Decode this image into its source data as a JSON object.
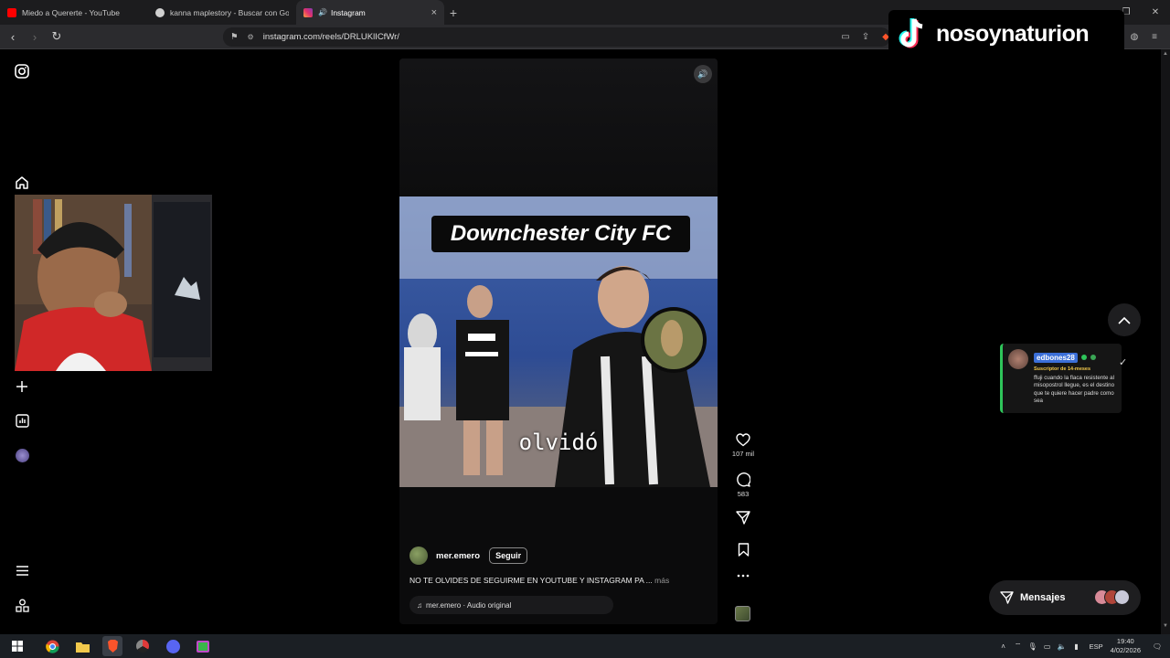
{
  "browser": {
    "tabs": [
      {
        "title": "Miedo a Quererte - YouTube",
        "favicon_color": "#ff0000",
        "active": false
      },
      {
        "title": "kanna maplestory - Buscar con Goog",
        "favicon_color": "#d0d0d0",
        "active": false
      },
      {
        "title": "Instagram",
        "favicon_color": "#e1306c",
        "active": true,
        "audio": true
      }
    ],
    "close_glyph": "×",
    "new_tab_glyph": "+",
    "url": "instagram.com/reels/DRLUKlICfWr/",
    "window_controls": [
      "—",
      "❐",
      "✕"
    ]
  },
  "overlay": {
    "tiktok_name": "nosoynaturion"
  },
  "reel": {
    "video_title": "Downchester City FC",
    "caption_word": "olvidó",
    "author": "mer.emero",
    "follow_label": "Seguir",
    "description": "NO TE OLVIDES DE SEGUIRME EN YOUTUBE Y INSTAGRAM PA ...",
    "more_label": " más",
    "audio_label": "mer.emero · Audio original",
    "likes": "107 mil",
    "comments": "583"
  },
  "chat": {
    "user": "edbones28",
    "subtitle": "Suscriptor de 14-meses",
    "message": "ffuji cuando la flaca resistente al misopostrol llegue, es el destino que te quiere hacer padre como sea"
  },
  "messages_label": "Mensajes",
  "colors": {
    "instagram_accent": "#e1306c",
    "chat_border": "#2ec45a",
    "chat_user_bg": "#3b6fd8",
    "sub_gold": "#f2c94c"
  },
  "taskbar": {
    "lang": "ESP",
    "time": "19:40",
    "date": "4/02/2026"
  }
}
